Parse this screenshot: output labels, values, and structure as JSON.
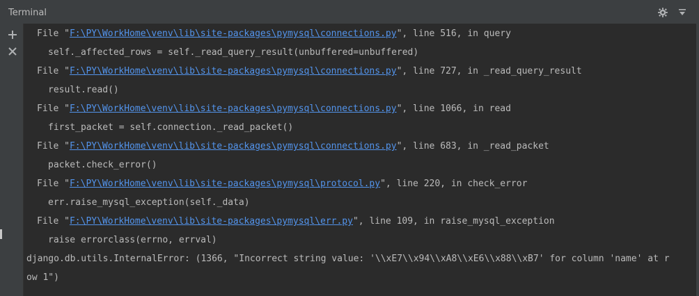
{
  "window": {
    "title": "Terminal"
  },
  "toolbar": {
    "settings_icon": "gear-icon",
    "hide_icon": "hide-panel-icon",
    "add_icon": "plus-icon",
    "close_icon": "close-icon"
  },
  "terminal": {
    "lines": [
      {
        "prefix": "File \"",
        "link": "F:\\PY\\WorkHome\\venv\\lib\\site-packages\\pymysql\\connections.py",
        "suffix": "\", line 516, in query"
      },
      {
        "text": "self._affected_rows = self._read_query_result(unbuffered=unbuffered)"
      },
      {
        "prefix": "File \"",
        "link": "F:\\PY\\WorkHome\\venv\\lib\\site-packages\\pymysql\\connections.py",
        "suffix": "\", line 727, in _read_query_result"
      },
      {
        "text": "result.read()"
      },
      {
        "prefix": "File \"",
        "link": "F:\\PY\\WorkHome\\venv\\lib\\site-packages\\pymysql\\connections.py",
        "suffix": "\", line 1066, in read"
      },
      {
        "text": "first_packet = self.connection._read_packet()"
      },
      {
        "prefix": "File \"",
        "link": "F:\\PY\\WorkHome\\venv\\lib\\site-packages\\pymysql\\connections.py",
        "suffix": "\", line 683, in _read_packet"
      },
      {
        "text": "packet.check_error()"
      },
      {
        "prefix": "File \"",
        "link": "F:\\PY\\WorkHome\\venv\\lib\\site-packages\\pymysql\\protocol.py",
        "suffix": "\", line 220, in check_error"
      },
      {
        "text": "err.raise_mysql_exception(self._data)"
      },
      {
        "prefix": "File \"",
        "link": "F:\\PY\\WorkHome\\venv\\lib\\site-packages\\pymysql\\err.py",
        "suffix": "\", line 109, in raise_mysql_exception"
      },
      {
        "text": "raise errorclass(errno, errval)"
      },
      {
        "text": "django.db.utils.InternalError: (1366, \"Incorrect string value: '\\\\xE7\\\\x94\\\\xA8\\\\xE6\\\\x88\\\\xB7' for column 'name' at r"
      },
      {
        "text": "ow 1\")"
      }
    ]
  },
  "colors": {
    "background": "#2b2b2b",
    "panel": "#3c3f41",
    "text": "#bbbbbb",
    "link": "#5394ec"
  }
}
